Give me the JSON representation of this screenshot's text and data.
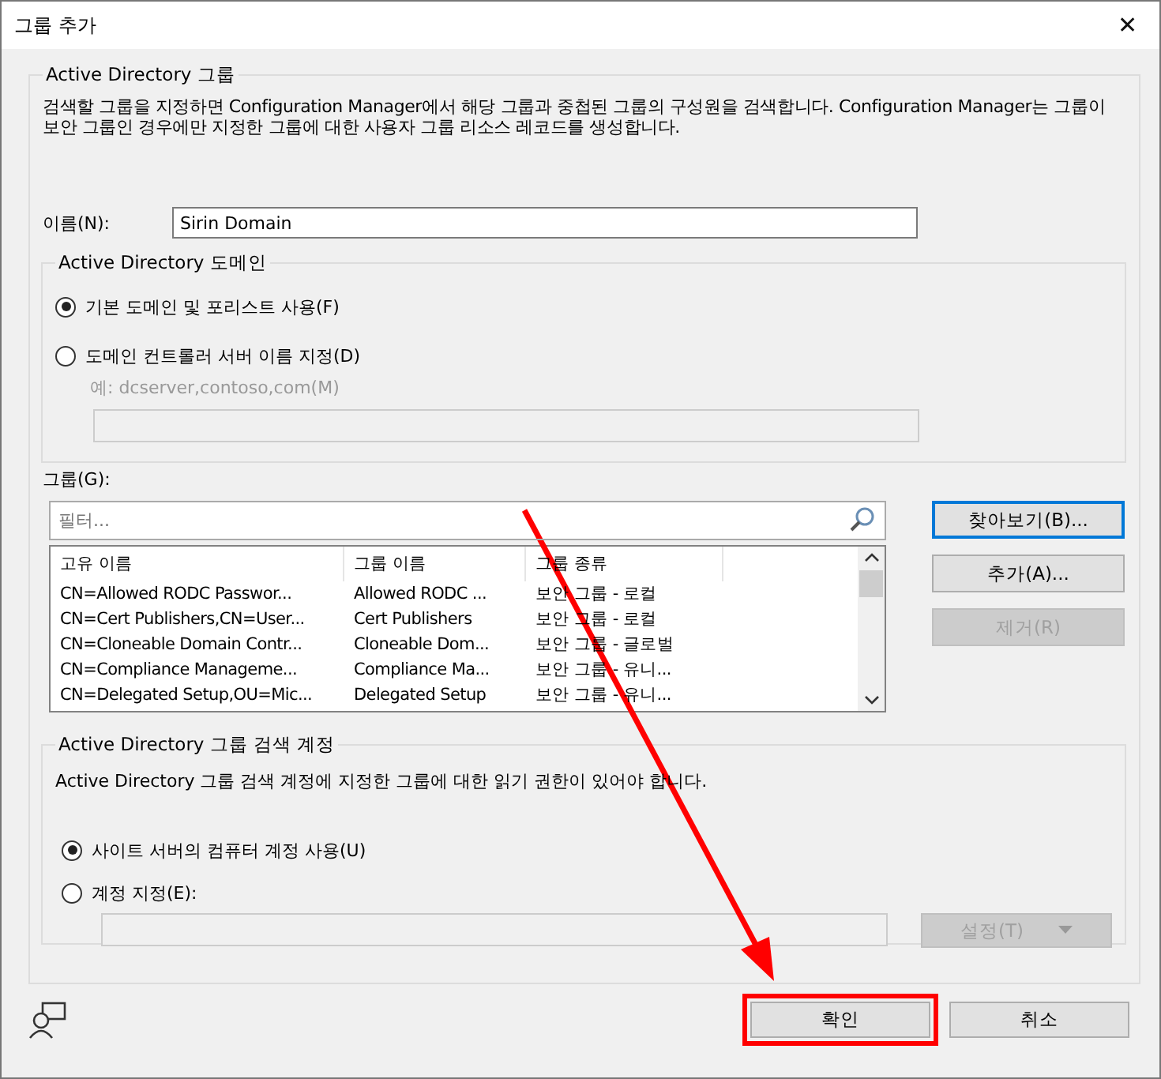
{
  "window": {
    "title": "그룹 추가",
    "close": "✕"
  },
  "ad_group": {
    "legend": "Active Directory 그룹",
    "description": "검색할 그룹을 지정하면 Configuration Manager에서 해당 그룹과 중첩된 그룹의 구성원을 검색합니다. Configuration Manager는 그룹이 보안 그룹인 경우에만 지정한 그룹에 대한 사용자 그룹 리소스 레코드를 생성합니다.",
    "name_label": "이름(N):",
    "name_value": "Sirin Domain"
  },
  "domain": {
    "legend": "Active Directory 도메인",
    "options": [
      {
        "label": "기본 도메인 및 포리스트 사용(F)",
        "selected": true
      },
      {
        "label": "도메인 컨트롤러 서버 이름 지정(D)",
        "selected": false
      }
    ],
    "hint": "예: dcserver,contoso,com(M)",
    "server_disabled": true
  },
  "groups": {
    "label": "그룹(G):",
    "filter_placeholder": "필터...",
    "columns": [
      "고유 이름",
      "그룹 이름",
      "그룹 종류"
    ],
    "rows": [
      [
        "CN=Allowed RODC Passwor...",
        "Allowed RODC ...",
        "보안 그룹 - 로컬"
      ],
      [
        "CN=Cert Publishers,CN=User...",
        "Cert Publishers",
        "보안 그룹 - 로컬"
      ],
      [
        "CN=Cloneable Domain Contr...",
        "Cloneable Dom...",
        "보안 그룹 - 글로벌"
      ],
      [
        "CN=Compliance Manageme...",
        "Compliance Ma...",
        "보안 그룹 - 유니..."
      ],
      [
        "CN=Delegated Setup,OU=Mic...",
        "Delegated Setup",
        "보안 그룹 - 유니..."
      ]
    ],
    "buttons": [
      {
        "label": "찾아보기(B)...",
        "disabled": false,
        "focused": true
      },
      {
        "label": "추가(A)...",
        "disabled": false,
        "focused": false
      },
      {
        "label": "제거(R)",
        "disabled": true,
        "focused": false
      }
    ]
  },
  "account": {
    "legend": "Active Directory 그룹 검색 계정",
    "description": "Active Directory 그룹 검색 계정에 지정한 그룹에 대한 읽기 권한이 있어야 합니다.",
    "options": [
      {
        "label": "사이트 서버의 컴퓨터 계정 사용(U)",
        "selected": true
      },
      {
        "label": "계정 지정(E):",
        "selected": false
      }
    ],
    "set_button": {
      "label": "설정(T)",
      "disabled": true
    }
  },
  "footer": {
    "buttons": [
      {
        "label": "확인",
        "highlighted": true
      },
      {
        "label": "취소",
        "highlighted": false
      }
    ]
  }
}
